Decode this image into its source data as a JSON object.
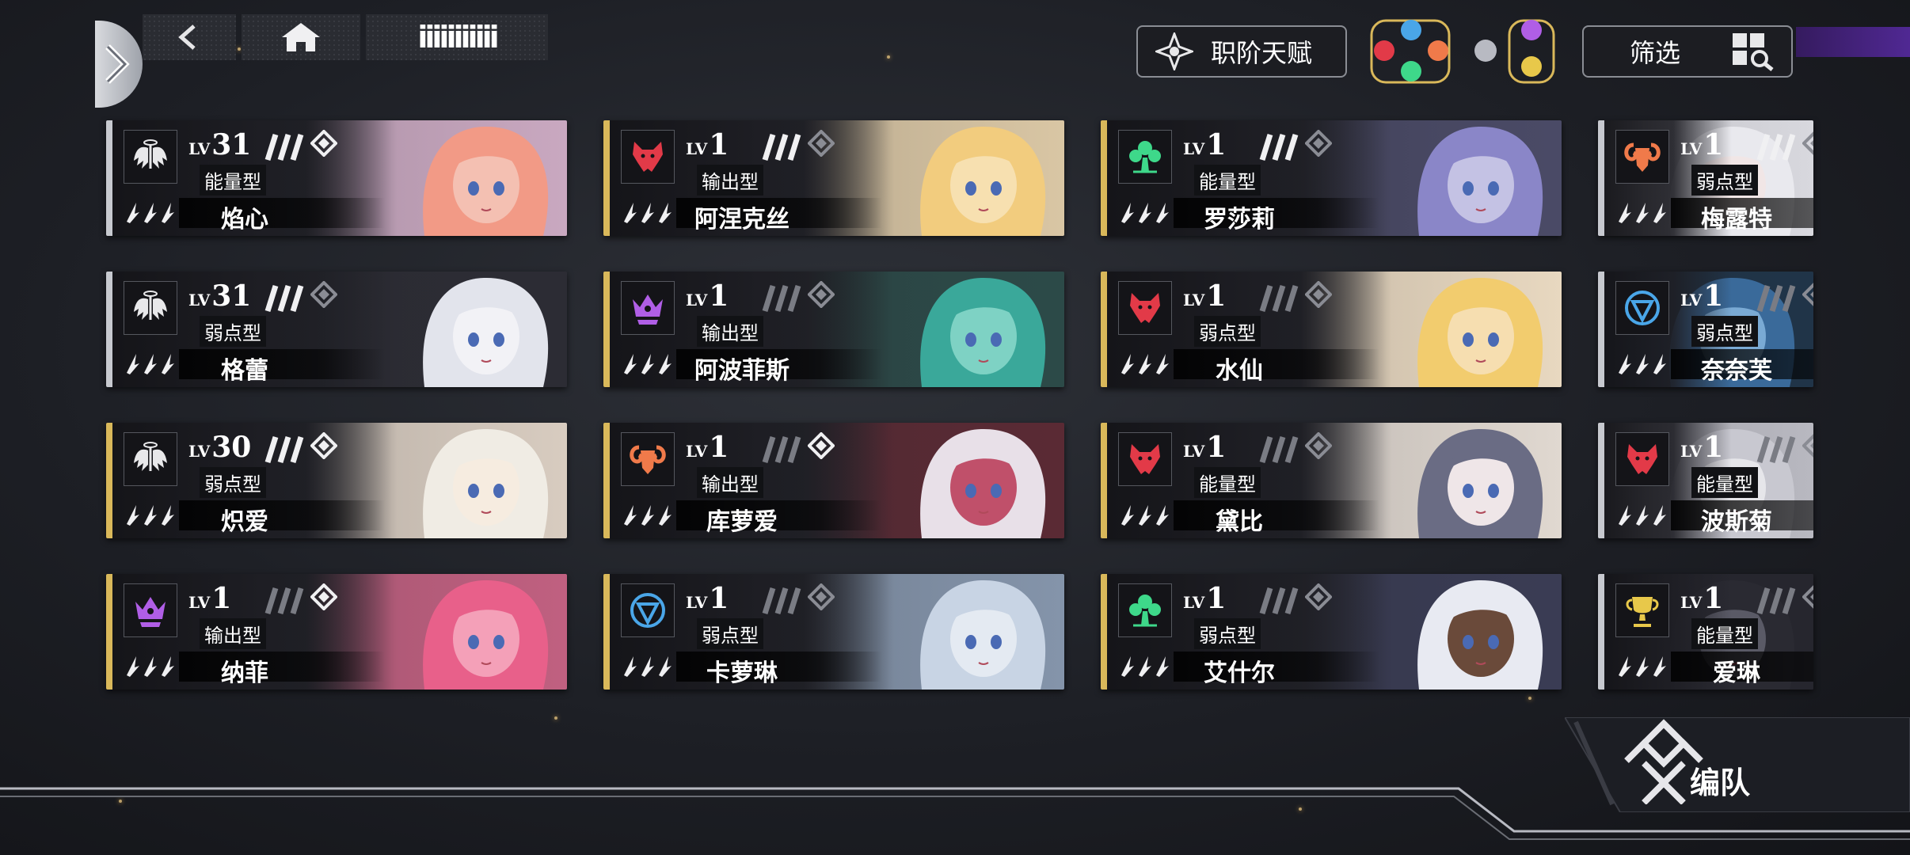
{
  "topbar": {
    "title": "iiiiiiiiiii",
    "talent_label": "职阶天赋",
    "filter_label": "筛选",
    "team_label": "编队"
  },
  "colors": {
    "gold": "#d9b85a",
    "silver": "#c7c9cf",
    "accent_purple": "#5a2ba8",
    "card_dark": "#1a1b20"
  },
  "cards": [
    {
      "name": "焰心",
      "lv": "31",
      "type": "能量型",
      "emblem": "wings-icon",
      "emblem_color": "#e8e8ea",
      "stripe": "#c7c9cf",
      "hair": "#f29a86",
      "tone": "#f4c0b2",
      "bg": "#c9a8c0"
    },
    {
      "name": "阿涅克丝",
      "lv": "1",
      "type": "输出型",
      "emblem": "wolf-icon",
      "emblem_color": "#e23a48",
      "stripe": "#d9b85a",
      "hair": "#f2cc7e",
      "tone": "#f7e0b0",
      "bg": "#d9c6a4"
    },
    {
      "name": "罗莎莉",
      "lv": "1",
      "type": "能量型",
      "emblem": "tree-icon",
      "emblem_color": "#3ed88a",
      "stripe": "#d9b85a",
      "hair": "#8a86c8",
      "tone": "#c4c2e4",
      "bg": "#4a4a66"
    },
    {
      "name": "梅露特",
      "lv": "1",
      "type": "弱点型",
      "emblem": "ram-icon",
      "emblem_color": "#f07a4a",
      "stripe": "#c7c9cf",
      "hair": "#e9e9ee",
      "tone": "#f1e6e6",
      "bg": "#d8d8de"
    },
    {
      "name": "格蕾",
      "lv": "31",
      "type": "弱点型",
      "emblem": "wings-icon",
      "emblem_color": "#e8e8ea",
      "stripe": "#c7c9cf",
      "hair": "#e2e4ec",
      "tone": "#f2f2f6",
      "bg": "#2c2c34"
    },
    {
      "name": "阿波菲斯",
      "lv": "1",
      "type": "输出型",
      "emblem": "crown-icon",
      "emblem_color": "#b05ee6",
      "stripe": "#d9b85a",
      "hair": "#3aa89a",
      "tone": "#7ed2c4",
      "bg": "#2c4a48"
    },
    {
      "name": "水仙",
      "lv": "1",
      "type": "弱点型",
      "emblem": "wolf-icon",
      "emblem_color": "#e23a48",
      "stripe": "#d9b85a",
      "hair": "#f2cc6e",
      "tone": "#f6deb0",
      "bg": "#e8d8c0"
    },
    {
      "name": "奈奈芙",
      "lv": "1",
      "type": "弱点型",
      "emblem": "shield-icon",
      "emblem_color": "#4aa6e8",
      "stripe": "#c7c9cf",
      "hair": "#3a6a9a",
      "tone": "#7aaad4",
      "bg": "#203448"
    },
    {
      "name": "炽爱",
      "lv": "30",
      "type": "弱点型",
      "emblem": "wings-icon",
      "emblem_color": "#e8e8ea",
      "stripe": "#d9b85a",
      "hair": "#f0ece4",
      "tone": "#f6ece0",
      "bg": "#d8ccc0"
    },
    {
      "name": "库萝爱",
      "lv": "1",
      "type": "输出型",
      "emblem": "ram-icon",
      "emblem_color": "#f07a4a",
      "stripe": "#d9b85a",
      "hair": "#e8e0e8",
      "tone": "#c0506a",
      "bg": "#5a2a34"
    },
    {
      "name": "黛比",
      "lv": "1",
      "type": "能量型",
      "emblem": "wolf-icon",
      "emblem_color": "#e23a48",
      "stripe": "#d9b85a",
      "hair": "#6a6c84",
      "tone": "#efe6e8",
      "bg": "#e0d8d0"
    },
    {
      "name": "波斯菊",
      "lv": "1",
      "type": "能量型",
      "emblem": "wolf-icon",
      "emblem_color": "#e23a48",
      "stripe": "#c7c9cf",
      "hair": "#c8c8d0",
      "tone": "#e6e6ea",
      "bg": "#b8b8c0"
    },
    {
      "name": "纳菲",
      "lv": "1",
      "type": "输出型",
      "emblem": "crown-icon",
      "emblem_color": "#b05ee6",
      "stripe": "#d9b85a",
      "hair": "#e8608a",
      "tone": "#f4a0b8",
      "bg": "#c06080"
    },
    {
      "name": "卡萝琳",
      "lv": "1",
      "type": "弱点型",
      "emblem": "shield-icon",
      "emblem_color": "#4aa6e8",
      "stripe": "#d9b85a",
      "hair": "#c8d4e4",
      "tone": "#e4eaf2",
      "bg": "#8494aa"
    },
    {
      "name": "艾什尔",
      "lv": "1",
      "type": "弱点型",
      "emblem": "tree-icon",
      "emblem_color": "#3ed88a",
      "stripe": "#d9b85a",
      "hair": "#e8eaf2",
      "tone": "#6a4a3a",
      "bg": "#3a3c54"
    },
    {
      "name": "爱琳",
      "lv": "1",
      "type": "能量型",
      "emblem": "trophy-icon",
      "emblem_color": "#e8c84a",
      "stripe": "#c7c9cf",
      "hair": "#2a2a32",
      "tone": "#5a5a66",
      "bg": "#26262e"
    }
  ]
}
